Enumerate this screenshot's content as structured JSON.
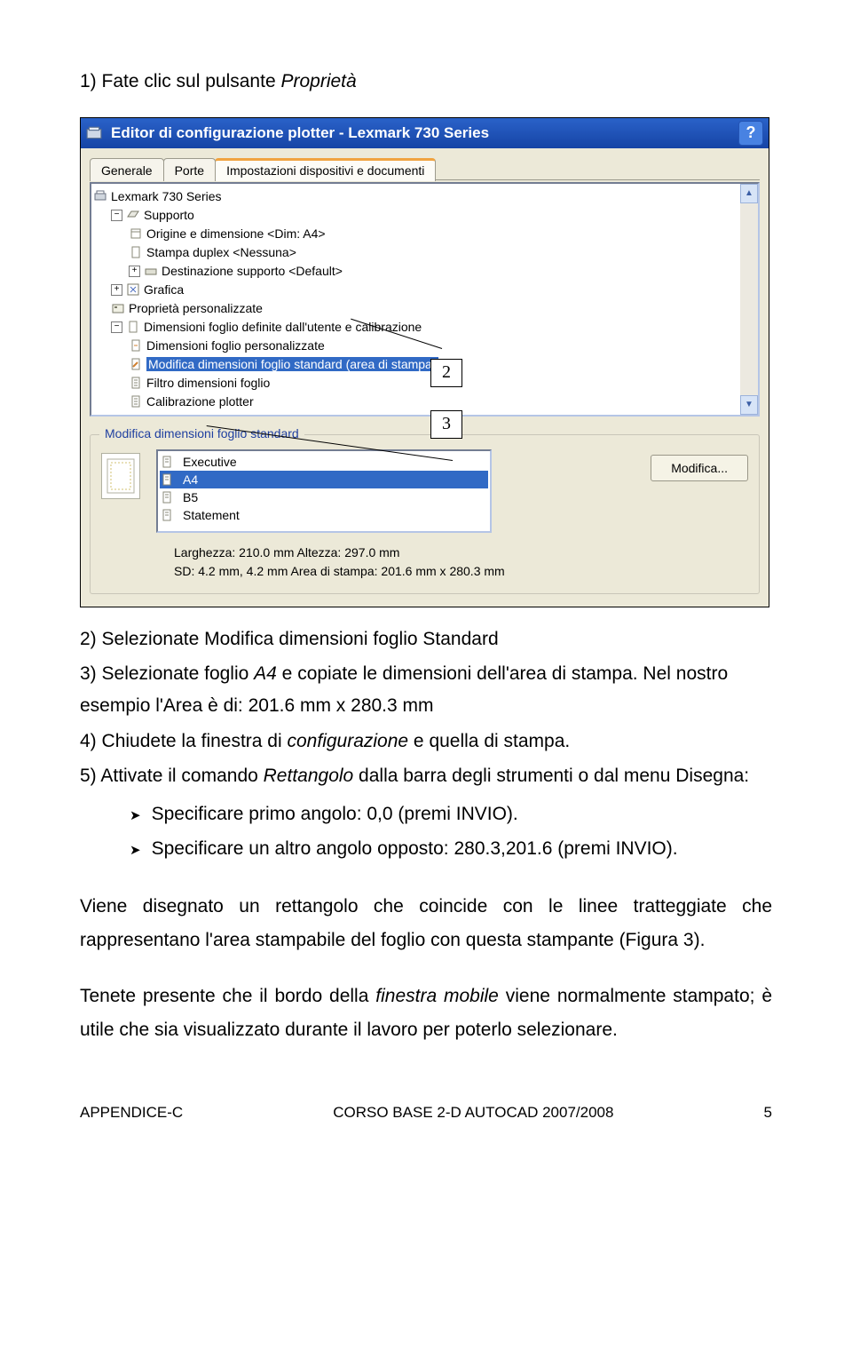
{
  "step1": {
    "num": "1)",
    "text": "Fate clic sul pulsante ",
    "em": "Proprietà"
  },
  "window": {
    "title": "Editor di configurazione plotter - Lexmark 730 Series",
    "help": "?",
    "tabs": {
      "t1": "Generale",
      "t2": "Porte",
      "t3": "Impostazioni dispositivi e documenti"
    },
    "tree": {
      "n0": "Lexmark 730 Series",
      "n1": "Supporto",
      "n2": "Origine e dimensione <Dim: A4>",
      "n3": "Stampa duplex <Nessuna>",
      "n4": "Destinazione supporto <Default>",
      "n5": "Grafica",
      "n6": "Proprietà personalizzate",
      "n7": "Dimensioni foglio definite dall'utente e calibrazione",
      "n8": "Dimensioni foglio personalizzate",
      "n9": "Modifica dimensioni foglio standard (area di stampa)",
      "n10": "Filtro dimensioni foglio",
      "n11": "Calibrazione plotter"
    },
    "group": {
      "legend": "Modifica dimensioni foglio standard",
      "items": {
        "i0": "Executive",
        "i1": "A4",
        "i2": "B5",
        "i3": "Statement"
      },
      "button": "Modifica...",
      "dim1": "Larghezza: 210.0 mm Altezza: 297.0 mm",
      "dim2": "SD: 4.2 mm, 4.2 mm  Area di stampa: 201.6 mm x 280.3 mm"
    }
  },
  "callouts": {
    "c2": "2",
    "c3": "3"
  },
  "step2": {
    "num": "2)",
    "text": "Selezionate Modifica dimensioni foglio Standard"
  },
  "step3": {
    "num": "3)",
    "pre": "Selezionate foglio ",
    "em": "A4",
    "post": " e copiate le dimensioni dell'area di stampa. Nel nostro esempio l'Area è di: 201.6 mm x 280.3 mm"
  },
  "step4": {
    "num": "4)",
    "pre": "Chiudete la finestra di ",
    "em": "configurazione",
    "post": " e quella di stampa."
  },
  "step5": {
    "num": "5)",
    "pre": "Attivate il comando ",
    "em": "Rettangolo",
    "post": " dalla barra degli strumenti o dal menu Disegna:"
  },
  "bullets": {
    "b1": "Specificare primo angolo: 0,0 (premi INVIO).",
    "b2": "Specificare un altro angolo opposto: 280.3,201.6 (premi INVIO)."
  },
  "para1": "Viene disegnato un rettangolo che coincide con le linee tratteggiate che rappresentano l'area stampabile del foglio con questa stampante (Figura 3).",
  "para2": {
    "pre": "Tenete presente che il bordo della ",
    "em": "finestra mobile",
    "post": " viene normalmente stampato; è utile che sia visualizzato durante il lavoro per poterlo selezionare."
  },
  "footer": {
    "left": "APPENDICE-C",
    "center": "CORSO BASE 2-D AUTOCAD 2007/2008",
    "right": "5"
  }
}
